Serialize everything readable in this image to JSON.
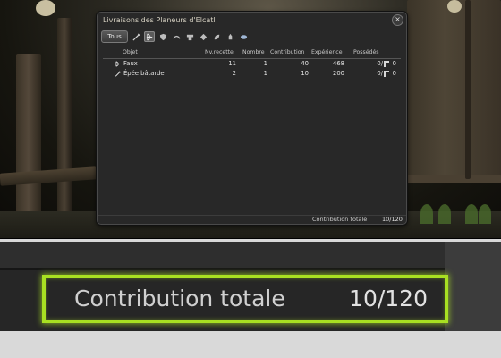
{
  "window": {
    "title": "Livraisons des Planeurs d'Elcatl",
    "close_label": "×"
  },
  "filters": {
    "all_label": "Tous",
    "icons": [
      "sword-icon",
      "bow-icon",
      "shield-icon",
      "hammer-icon",
      "anvil-icon",
      "gem-icon",
      "leaf-icon",
      "pot-icon",
      "fish-icon"
    ]
  },
  "columns": {
    "item": "Objet",
    "recipe_level": "Nv.recette",
    "count": "Nombre",
    "contribution": "Contribution",
    "experience": "Expérience",
    "owned": "Possédés"
  },
  "rows": [
    {
      "name": "Faux",
      "recipe_level": "11",
      "count": "1",
      "contribution": "40",
      "experience": "468",
      "owned": "0/",
      "owned_hq": "0"
    },
    {
      "name": "Épée bâtarde",
      "recipe_level": "2",
      "count": "1",
      "contribution": "10",
      "experience": "200",
      "owned": "0/",
      "owned_hq": "0"
    }
  ],
  "footer": {
    "total_label": "Contribution totale",
    "total_value": "10/120"
  },
  "zoom": {
    "total_label": "Contribution totale",
    "total_value": "10/120"
  },
  "colors": {
    "highlight": "#a8e022",
    "window_bg": "#282828"
  }
}
